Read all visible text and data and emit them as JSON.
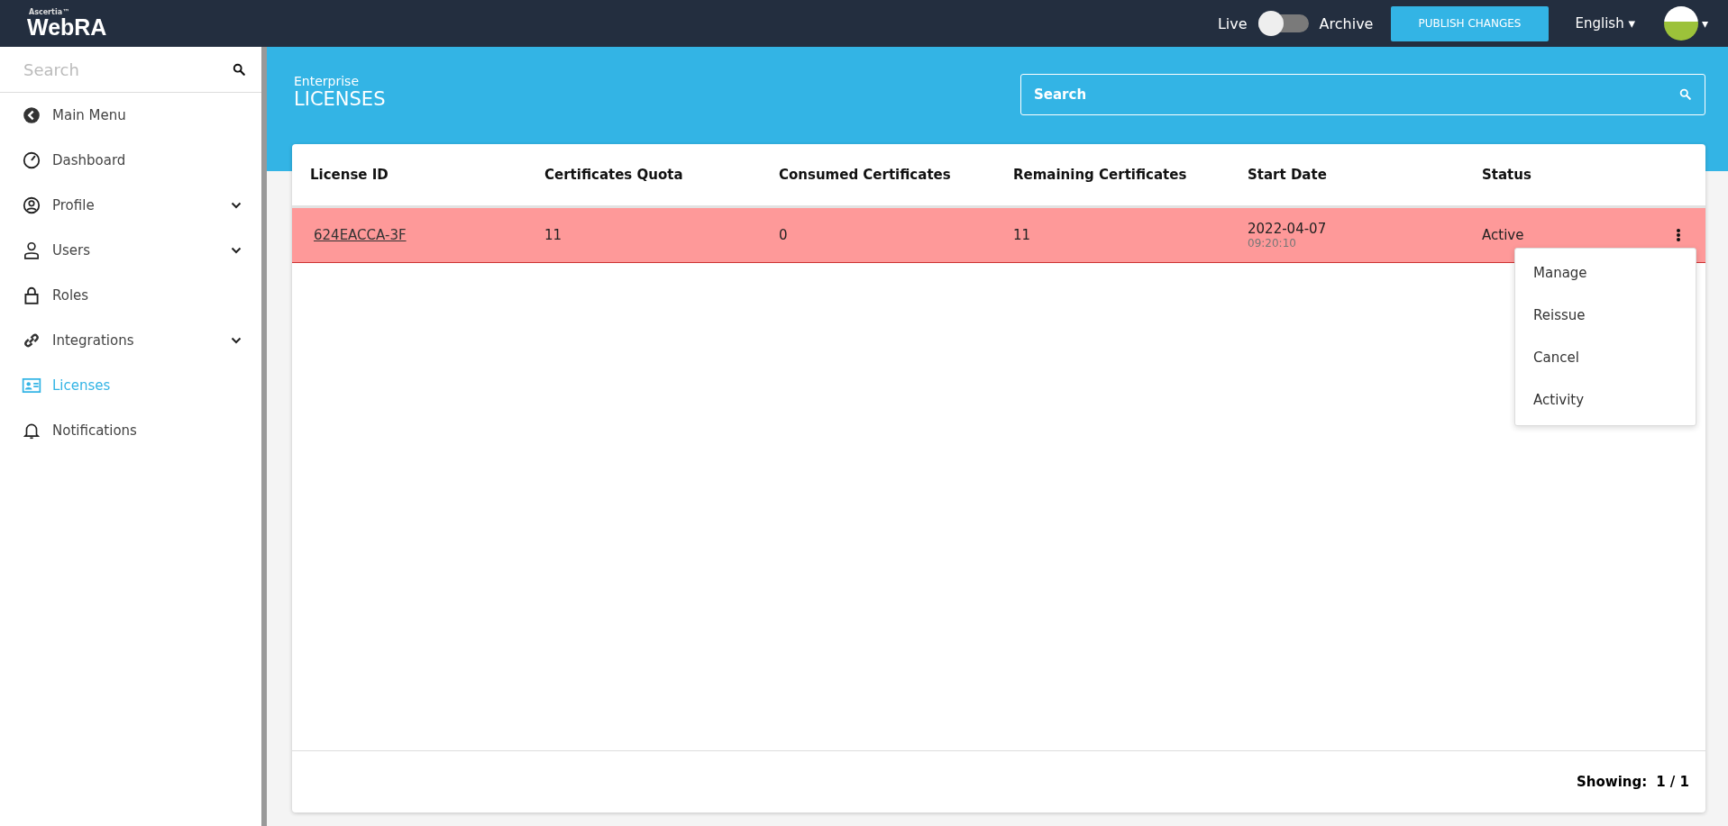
{
  "topbar": {
    "brand_small": "Ascertia™",
    "brand": "WebRA",
    "toggle": {
      "left_label": "Live",
      "right_label": "Archive",
      "on": false
    },
    "publish_button": "PUBLISH CHANGES",
    "language": "English ▾",
    "avatar_caret": "▾"
  },
  "sidebar": {
    "search": {
      "placeholder": "Search"
    },
    "items": [
      {
        "label": "Main Menu",
        "expandable": false,
        "selected": false
      },
      {
        "label": "Dashboard",
        "expandable": false,
        "selected": false
      },
      {
        "label": "Profile",
        "expandable": true,
        "selected": false
      },
      {
        "label": "Users",
        "expandable": true,
        "selected": false
      },
      {
        "label": "Roles",
        "expandable": false,
        "selected": false
      },
      {
        "label": "Integrations",
        "expandable": true,
        "selected": false
      },
      {
        "label": "Licenses",
        "expandable": false,
        "selected": true
      },
      {
        "label": "Notifications",
        "expandable": false,
        "selected": false
      }
    ]
  },
  "header": {
    "subtitle": "Enterprise",
    "title": "LICENSES",
    "search": {
      "placeholder": "Search"
    }
  },
  "table": {
    "columns": [
      "License ID",
      "Certificates Quota",
      "Consumed Certificates",
      "Remaining Certificates",
      "Start Date",
      "Status"
    ],
    "rows": [
      {
        "license_id": "624EACCA-3F",
        "quota": "11",
        "consumed": "0",
        "remaining": "11",
        "start_date": "2022-04-07",
        "start_time": "09:20:10",
        "status": "Active",
        "selected": true,
        "menu_open": true
      }
    ],
    "row_menu": [
      "Manage",
      "Reissue",
      "Cancel",
      "Activity"
    ],
    "footer": {
      "label": "Showing:",
      "value": "1 / 1"
    }
  }
}
